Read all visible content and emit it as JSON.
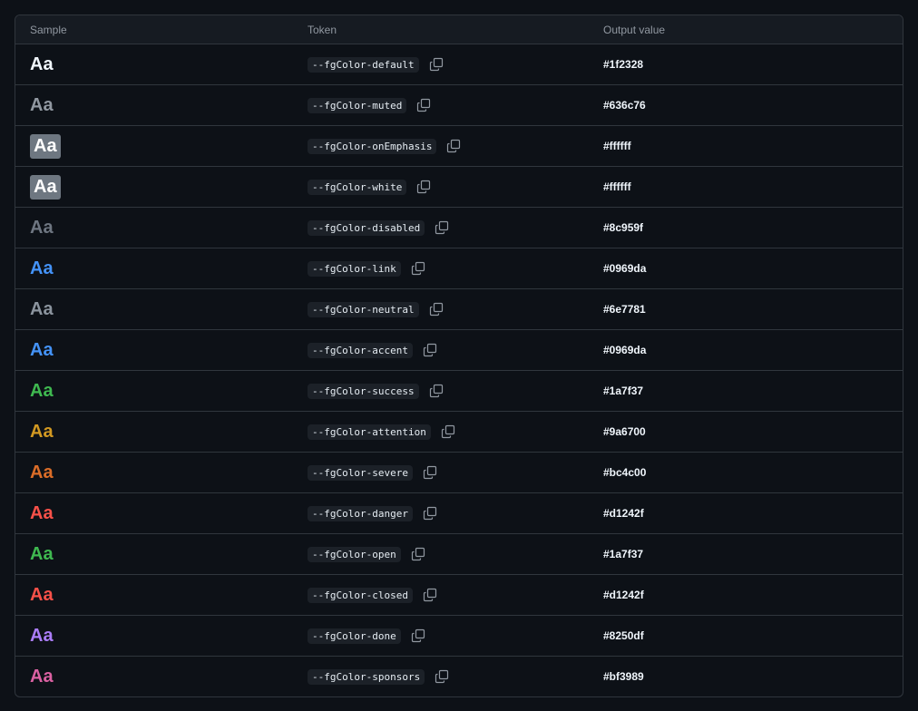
{
  "headers": {
    "sample": "Sample",
    "token": "Token",
    "value": "Output value"
  },
  "sample_text": "Aa",
  "rows": [
    {
      "token": "--fgColor-default",
      "value": "#1f2328",
      "color": "#f0f6fc",
      "boxed": false
    },
    {
      "token": "--fgColor-muted",
      "value": "#636c76",
      "color": "#9198a1",
      "boxed": false
    },
    {
      "token": "--fgColor-onEmphasis",
      "value": "#ffffff",
      "color": "#ffffff",
      "boxed": true
    },
    {
      "token": "--fgColor-white",
      "value": "#ffffff",
      "color": "#ffffff",
      "boxed": true
    },
    {
      "token": "--fgColor-disabled",
      "value": "#8c959f",
      "color": "#6e7681",
      "boxed": false
    },
    {
      "token": "--fgColor-link",
      "value": "#0969da",
      "color": "#4493f8",
      "boxed": false
    },
    {
      "token": "--fgColor-neutral",
      "value": "#6e7781",
      "color": "#8b949e",
      "boxed": false
    },
    {
      "token": "--fgColor-accent",
      "value": "#0969da",
      "color": "#4493f8",
      "boxed": false
    },
    {
      "token": "--fgColor-success",
      "value": "#1a7f37",
      "color": "#3fb950",
      "boxed": false
    },
    {
      "token": "--fgColor-attention",
      "value": "#9a6700",
      "color": "#d29922",
      "boxed": false
    },
    {
      "token": "--fgColor-severe",
      "value": "#bc4c00",
      "color": "#db6d28",
      "boxed": false
    },
    {
      "token": "--fgColor-danger",
      "value": "#d1242f",
      "color": "#f85149",
      "boxed": false
    },
    {
      "token": "--fgColor-open",
      "value": "#1a7f37",
      "color": "#3fb950",
      "boxed": false
    },
    {
      "token": "--fgColor-closed",
      "value": "#d1242f",
      "color": "#f85149",
      "boxed": false
    },
    {
      "token": "--fgColor-done",
      "value": "#8250df",
      "color": "#ab7df8",
      "boxed": false
    },
    {
      "token": "--fgColor-sponsors",
      "value": "#bf3989",
      "color": "#db61a2",
      "boxed": false
    }
  ]
}
